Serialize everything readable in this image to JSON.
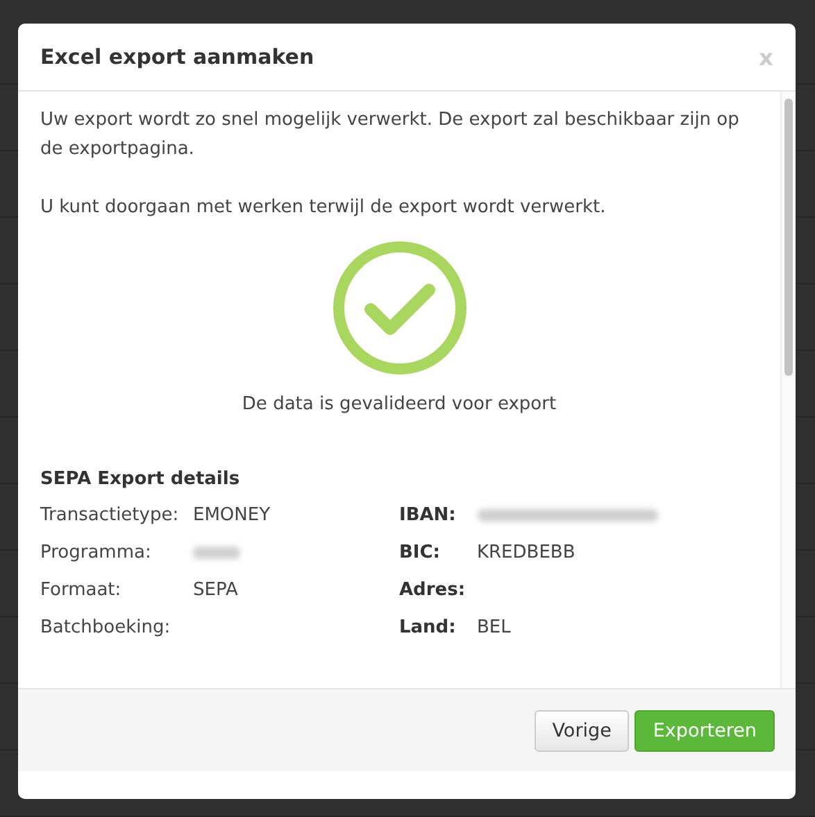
{
  "dialog": {
    "title": "Excel export aanmaken",
    "close": "x",
    "paragraphs": [
      "Uw export wordt zo snel mogelijk verwerkt. De export zal beschikbaar zijn op de exportpagina.",
      "U kunt doorgaan met werken terwijl de export wordt verwerkt."
    ],
    "status": "De data is gevalideerd voor export",
    "details_title": "SEPA Export details",
    "left_fields": [
      {
        "label": "Transactietype:",
        "value": "EMONEY"
      },
      {
        "label": "Programma:",
        "redacted": true
      },
      {
        "label": "Formaat:",
        "value": "SEPA"
      },
      {
        "label": "Batchboeking:"
      }
    ],
    "right_fields": [
      {
        "label": "IBAN:",
        "redacted": true
      },
      {
        "label": "BIC:",
        "value": "KREDBEBB"
      },
      {
        "label": "Adres:"
      },
      {
        "label": "Land:",
        "value": "BEL"
      }
    ],
    "buttons": [
      {
        "label": "Vorige",
        "kind": "secondary"
      },
      {
        "label": "Exporteren",
        "kind": "primary"
      }
    ]
  }
}
